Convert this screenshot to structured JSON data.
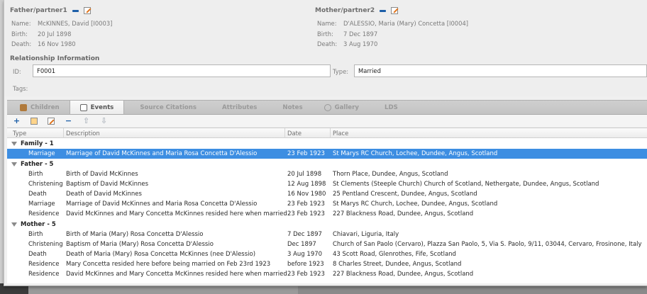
{
  "father": {
    "heading": "Father/partner1",
    "name_label": "Name:",
    "name": "McKINNES, David [I0003]",
    "birth_label": "Birth:",
    "birth": "20 Jul 1898",
    "death_label": "Death:",
    "death": "16 Nov 1980"
  },
  "mother": {
    "heading": "Mother/partner2",
    "name_label": "Name:",
    "name": "D'ALESSIO, Maria (Mary) Concetta [I0004]",
    "birth_label": "Birth:",
    "birth": "7 Dec 1897",
    "death_label": "Death:",
    "death": "3 Aug 1970"
  },
  "relationship": {
    "title": "Relationship Information",
    "id_label": "ID:",
    "id_value": "F0001",
    "type_label": "Type:",
    "type_value": "Married",
    "tags_label": "Tags:"
  },
  "tabs": [
    {
      "label": "Children",
      "icon": "children-icon"
    },
    {
      "label": "Events",
      "icon": "events-icon"
    },
    {
      "label": "Source Citations",
      "icon": ""
    },
    {
      "label": "Attributes",
      "icon": ""
    },
    {
      "label": "Notes",
      "icon": ""
    },
    {
      "label": "Gallery",
      "icon": "gallery-icon"
    },
    {
      "label": "LDS",
      "icon": ""
    }
  ],
  "toolbar": {
    "add_icon": "plus-icon",
    "share_icon": "share-icon",
    "edit_icon": "edit-icon",
    "remove_icon": "minus-icon",
    "up_icon": "arrow-up-icon",
    "down_icon": "arrow-down-icon"
  },
  "columns": {
    "type": "Type",
    "description": "Description",
    "date": "Date",
    "place": "Place"
  },
  "groups": [
    {
      "label": "Family - 1",
      "rows": [
        {
          "type": "Marriage",
          "description": "Marriage of David McKinnes and Maria Rosa Concetta D'Alessio",
          "date": "23 Feb 1923",
          "place": "St Marys RC Church, Lochee, Dundee, Angus, Scotland",
          "selected": true
        }
      ]
    },
    {
      "label": "Father - 5",
      "rows": [
        {
          "type": "Birth",
          "description": "Birth of David McKinnes",
          "date": "20 Jul 1898",
          "place": "Thorn Place, Dundee, Angus, Scotland"
        },
        {
          "type": "Christening",
          "description": "Baptism of David McKinnes",
          "date": "12 Aug 1898",
          "place": "St Clements (Steeple Church) Church of Scotland, Nethergate, Dundee, Angus, Scotland"
        },
        {
          "type": "Death",
          "description": "Death of David McKinnes",
          "date": "16 Nov 1980",
          "place": "25 Pentland Crescent, Dundee, Angus, Scotland"
        },
        {
          "type": "Marriage",
          "description": "Marriage of David McKinnes and Maria Rosa Concetta D'Alessio",
          "date": "23 Feb 1923",
          "place": "St Marys RC Church, Lochee, Dundee, Angus, Scotland"
        },
        {
          "type": "Residence",
          "description": "David McKinnes and Mary Concetta McKinnes resided here when married",
          "date": "23 Feb 1923",
          "place": "227 Blackness Road, Dundee, Angus, Scotland"
        }
      ]
    },
    {
      "label": "Mother - 5",
      "rows": [
        {
          "type": "Birth",
          "description": "Birth of Maria (Mary) Rosa Concetta D'Alessio",
          "date": "7 Dec 1897",
          "place": "Chiavari, Liguria, Italy"
        },
        {
          "type": "Christening",
          "description": "Baptism of Maria (Mary) Rosa Concetta D'Alessio",
          "date": "Dec 1897",
          "place": "Church of San Paolo (Cervaro), Plazza San Paolo, 5, Via S. Paolo, 9/11, 03044, Cervaro, Frosinone, Italy"
        },
        {
          "type": "Death",
          "description": "Death of Maria (Mary) Rosa Concetta McKinnes (nee D'Alessio)",
          "date": "3 Aug 1970",
          "place": "43 Scott Road, Glenrothes, Fife, Scotland"
        },
        {
          "type": "Residence",
          "description": "Mary Concetta resided here before being married on Feb 23rd 1923",
          "date": "before 1923",
          "place": "8 Charles Street, Dundee, Angus, Scotland"
        },
        {
          "type": "Residence",
          "description": "David McKinnes and Mary Concetta McKinnes resided here when married",
          "date": "23 Feb 1923",
          "place": "227 Blackness Road, Dundee, Angus, Scotland"
        }
      ]
    }
  ],
  "colors": {
    "selection": "#3d8ee2",
    "accent_blue": "#1d5fa8",
    "edit_orange": "#e0731b"
  }
}
